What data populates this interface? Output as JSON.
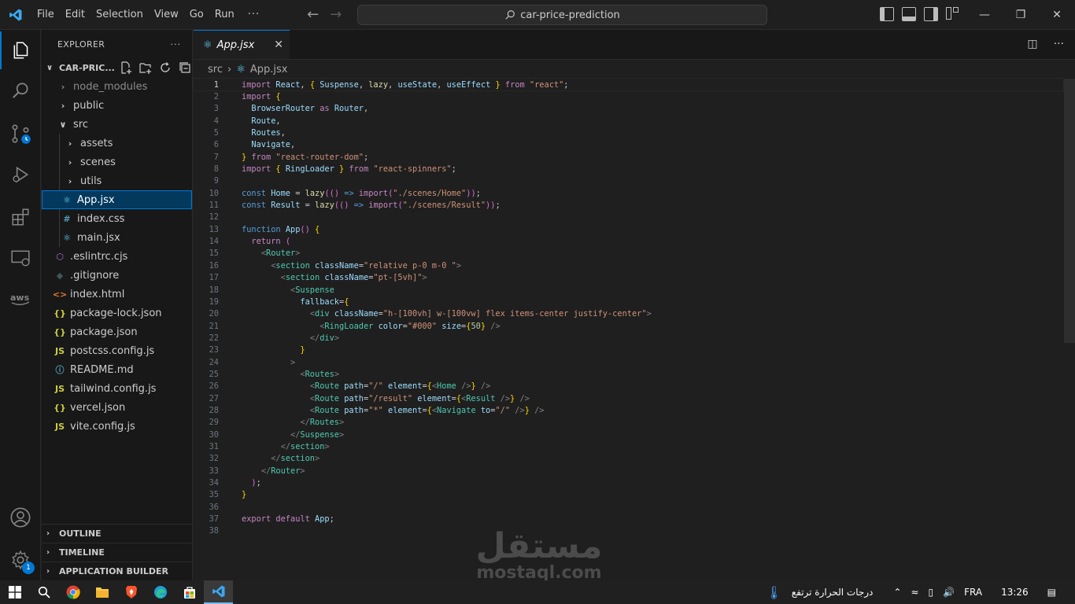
{
  "titlebar": {
    "menu": [
      "File",
      "Edit",
      "Selection",
      "View",
      "Go",
      "Run"
    ],
    "more": "···",
    "search_text": "car-price-prediction"
  },
  "explorer": {
    "title": "EXPLORER",
    "more": "···",
    "project": "CAR-PRIC...",
    "items": [
      {
        "label": "node_modules",
        "kind": "folder",
        "depth": 1,
        "dim": true
      },
      {
        "label": "public",
        "kind": "folder",
        "depth": 1
      },
      {
        "label": "src",
        "kind": "folder-open",
        "depth": 1
      },
      {
        "label": "assets",
        "kind": "folder",
        "depth": 2
      },
      {
        "label": "scenes",
        "kind": "folder",
        "depth": 2
      },
      {
        "label": "utils",
        "kind": "folder",
        "depth": 2
      },
      {
        "label": "App.jsx",
        "kind": "react",
        "depth": 2,
        "selected": true
      },
      {
        "label": "index.css",
        "kind": "css",
        "depth": 2
      },
      {
        "label": "main.jsx",
        "kind": "react",
        "depth": 2
      },
      {
        "label": ".eslintrc.cjs",
        "kind": "eslint",
        "depth": 1
      },
      {
        "label": ".gitignore",
        "kind": "git",
        "depth": 1
      },
      {
        "label": "index.html",
        "kind": "html",
        "depth": 1
      },
      {
        "label": "package-lock.json",
        "kind": "json",
        "depth": 1
      },
      {
        "label": "package.json",
        "kind": "json",
        "depth": 1
      },
      {
        "label": "postcss.config.js",
        "kind": "js",
        "depth": 1
      },
      {
        "label": "README.md",
        "kind": "info",
        "depth": 1
      },
      {
        "label": "tailwind.config.js",
        "kind": "js",
        "depth": 1
      },
      {
        "label": "vercel.json",
        "kind": "json",
        "depth": 1
      },
      {
        "label": "vite.config.js",
        "kind": "js",
        "depth": 1
      }
    ],
    "sections": [
      "OUTLINE",
      "TIMELINE",
      "APPLICATION BUILDER"
    ]
  },
  "editor": {
    "tab": "App.jsx",
    "breadcrumb": [
      "src",
      "App.jsx"
    ],
    "current_line": 1,
    "lines": [
      "import React, { Suspense, lazy, useState, useEffect } from \"react\";",
      "import {",
      "  BrowserRouter as Router,",
      "  Route,",
      "  Routes,",
      "  Navigate,",
      "} from \"react-router-dom\";",
      "import { RingLoader } from \"react-spinners\";",
      "",
      "const Home = lazy(() => import(\"./scenes/Home\"));",
      "const Result = lazy(() => import(\"./scenes/Result\"));",
      "",
      "function App() {",
      "  return (",
      "    <Router>",
      "      <section className=\"relative p-0 m-0 \">",
      "        <section className=\"pt-[5vh]\">",
      "          <Suspense",
      "            fallback={",
      "              <div className=\"h-[100vh] w-[100vw] flex items-center justify-center\">",
      "                <RingLoader color=\"#000\" size={50} />",
      "              </div>",
      "            }",
      "          >",
      "            <Routes>",
      "              <Route path=\"/\" element={<Home />} />",
      "              <Route path=\"/result\" element={<Result />} />",
      "              <Route path=\"*\" element={<Navigate to=\"/\" />} />",
      "            </Routes>",
      "          </Suspense>",
      "        </section>",
      "      </section>",
      "    </Router>",
      "  );",
      "}",
      "",
      "export default App;",
      ""
    ]
  },
  "activity": {
    "settings_badge": "1"
  },
  "watermark": {
    "arabic": "مستقل",
    "latin": "mostaql.com"
  },
  "taskbar": {
    "weather": "درجات الحرارة ترتفع",
    "lang": "FRA",
    "time": "13:26"
  },
  "colors": {
    "accent": "#0078d4",
    "selection_bg": "#04395e"
  }
}
